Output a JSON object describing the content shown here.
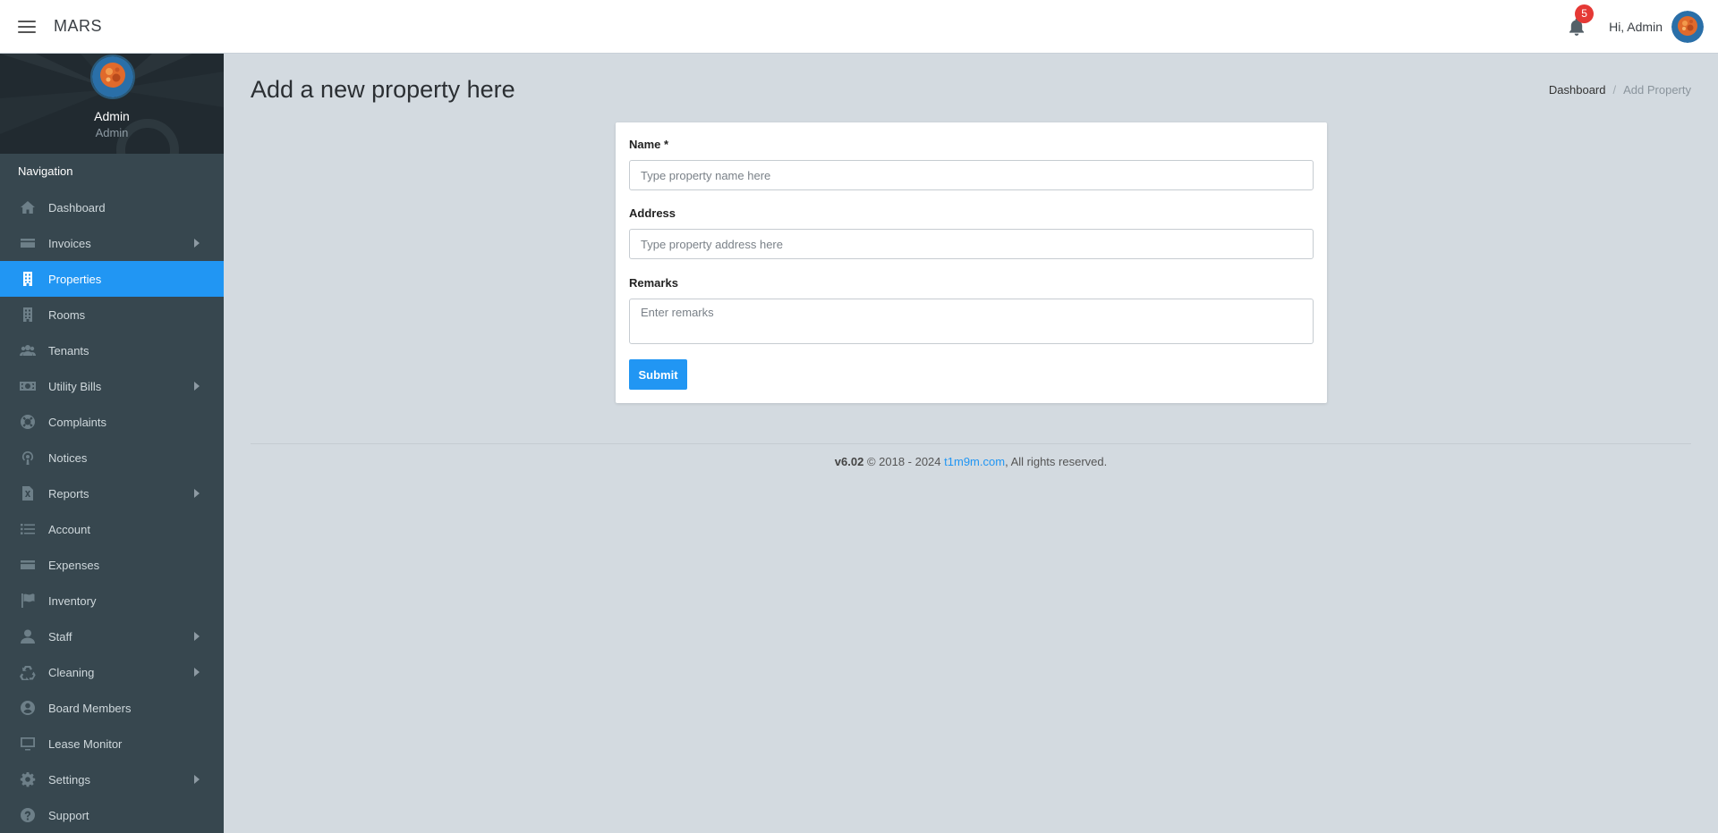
{
  "app": {
    "title": "MARS"
  },
  "header": {
    "notification_count": "5",
    "greeting": "Hi, Admin"
  },
  "sidebar": {
    "profile": {
      "name": "Admin",
      "role": "Admin"
    },
    "nav_header": "Navigation",
    "items": [
      {
        "label": "Dashboard",
        "icon": "home-icon",
        "has_submenu": false,
        "active": false
      },
      {
        "label": "Invoices",
        "icon": "credit-card-icon",
        "has_submenu": true,
        "active": false
      },
      {
        "label": "Properties",
        "icon": "building-icon",
        "has_submenu": false,
        "active": true
      },
      {
        "label": "Rooms",
        "icon": "building-icon",
        "has_submenu": false,
        "active": false
      },
      {
        "label": "Tenants",
        "icon": "users-icon",
        "has_submenu": false,
        "active": false
      },
      {
        "label": "Utility Bills",
        "icon": "money-bill-icon",
        "has_submenu": true,
        "active": false
      },
      {
        "label": "Complaints",
        "icon": "life-ring-icon",
        "has_submenu": false,
        "active": false
      },
      {
        "label": "Notices",
        "icon": "podcast-icon",
        "has_submenu": false,
        "active": false
      },
      {
        "label": "Reports",
        "icon": "excel-file-icon",
        "has_submenu": true,
        "active": false
      },
      {
        "label": "Account",
        "icon": "list-icon",
        "has_submenu": false,
        "active": false
      },
      {
        "label": "Expenses",
        "icon": "credit-card-icon",
        "has_submenu": false,
        "active": false
      },
      {
        "label": "Inventory",
        "icon": "flag-icon",
        "has_submenu": false,
        "active": false
      },
      {
        "label": "Staff",
        "icon": "user-icon",
        "has_submenu": true,
        "active": false
      },
      {
        "label": "Cleaning",
        "icon": "recycle-icon",
        "has_submenu": true,
        "active": false
      },
      {
        "label": "Board Members",
        "icon": "user-circle-icon",
        "has_submenu": false,
        "active": false
      },
      {
        "label": "Lease Monitor",
        "icon": "desktop-icon",
        "has_submenu": false,
        "active": false
      },
      {
        "label": "Settings",
        "icon": "gear-icon",
        "has_submenu": true,
        "active": false
      },
      {
        "label": "Support",
        "icon": "question-circle-icon",
        "has_submenu": false,
        "active": false
      }
    ]
  },
  "page": {
    "title": "Add a new property here",
    "breadcrumb": {
      "parent": "Dashboard",
      "current": "Add Property"
    }
  },
  "form": {
    "name_label": "Name *",
    "name_value": "",
    "name_placeholder": "Type property name here",
    "address_label": "Address",
    "address_value": "",
    "address_placeholder": "Type property address here",
    "remarks_label": "Remarks",
    "remarks_value": "",
    "remarks_placeholder": "Enter remarks",
    "submit_label": "Submit"
  },
  "footer": {
    "version": "v6.02",
    "copyright": "© 2018 - 2024",
    "link_text": "t1m9m.com",
    "rights": ", All rights reserved."
  },
  "colors": {
    "accent": "#2196f3",
    "sidebar_bg": "#37474f",
    "content_bg": "#d3dae0",
    "badge": "#e53935"
  }
}
